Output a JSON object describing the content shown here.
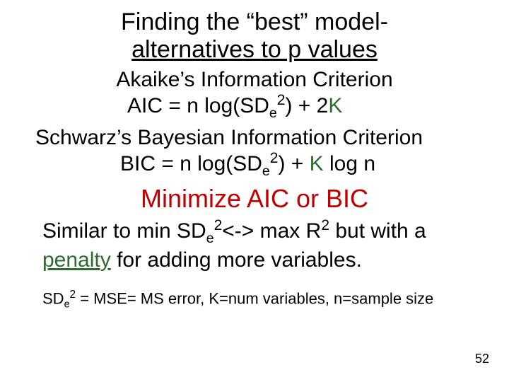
{
  "title": {
    "line1": "Finding the “best” model-",
    "line2": "alternatives to p values"
  },
  "akaike": {
    "heading": "Akaike’s Information Criterion",
    "lhs": "AIC = n log(SD",
    "sub": "e",
    "sup": "2",
    "mid": ") + 2",
    "K": "K"
  },
  "bic": {
    "heading": "Schwarz’s Bayesian Information Criterion",
    "lhs": "BIC = n log(SD",
    "sub": "e",
    "sup": "2",
    "mid": ") + ",
    "K": "K",
    "tail": " log n"
  },
  "minimize": "Minimize AIC or BIC",
  "similar": {
    "p1a": "Similar to min SD",
    "p1sub": "e",
    "p1sup": "2",
    "p1b": "<-> max R",
    "p1sup2": "2",
    "p1c": " but with a ",
    "penalty": "penalty",
    "p1d": " for adding more variables."
  },
  "footnote": {
    "a": "SD",
    "sub": "e",
    "sup": "2",
    "b": " = MSE= MS error, K=num variables, n=sample size"
  },
  "page": "52"
}
